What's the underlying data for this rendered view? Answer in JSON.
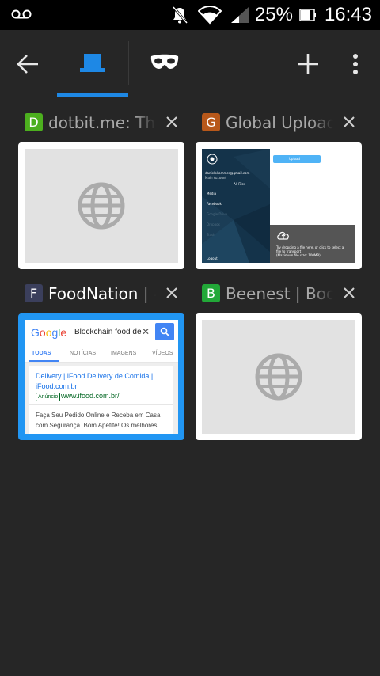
{
  "status_bar": {
    "battery_percent": "25%",
    "time": "16:43"
  },
  "toolbar": {
    "back_icon": "arrow-left-icon",
    "normal_tabs_icon": "tab-switcher-icon",
    "incognito_icon": "incognito-mask-icon",
    "add_icon": "plus-icon",
    "menu_icon": "more-vert-icon",
    "accent_color": "#1e88e5"
  },
  "tabs": [
    {
      "favicon_letter": "D",
      "favicon_color": "#4caf1e",
      "title": "dotbit.me: The",
      "thumbnail": "globe-placeholder",
      "selected": false
    },
    {
      "favicon_letter": "G",
      "favicon_color": "#b8581a",
      "title": "Global Upload",
      "thumbnail": "upload-page",
      "selected": false,
      "preview": {
        "email": "danielpl.ammer@gmail.com",
        "account": "Main Account",
        "all_files": "All Files",
        "menu": [
          "Media",
          "Facebook",
          "Google Drive",
          "Dropbox",
          "Trash"
        ],
        "logout": "Logout",
        "upload_button": "Upload",
        "drop_text_1": "Try dropping a file here, or click to select a",
        "drop_text_2": "file to transport",
        "drop_text_3": "(Maximum file size: 100MB)"
      }
    },
    {
      "favicon_letter": "F",
      "favicon_color": "#3b3f5c",
      "title": "FoodNation | #",
      "thumbnail": "google-search",
      "selected": true,
      "preview": {
        "logo": "Google",
        "query": "Blockchain food de",
        "tabs": [
          "TODAS",
          "NOTÍCIAS",
          "IMAGENS",
          "VÍDEOS"
        ],
        "result_title": "Delivery | iFood Delivery de Comida | iFood.com.br",
        "ad_label": "Anúncio",
        "result_url": "www.ifood.com.br/",
        "snippet": "Faça Seu Pedido Online e Receba em Casa com Segurança. Bom Apetite! Os melhores"
      }
    },
    {
      "favicon_letter": "B",
      "favicon_color": "#22a838",
      "title": "Beenest | Book",
      "thumbnail": "globe-placeholder",
      "selected": false
    }
  ]
}
